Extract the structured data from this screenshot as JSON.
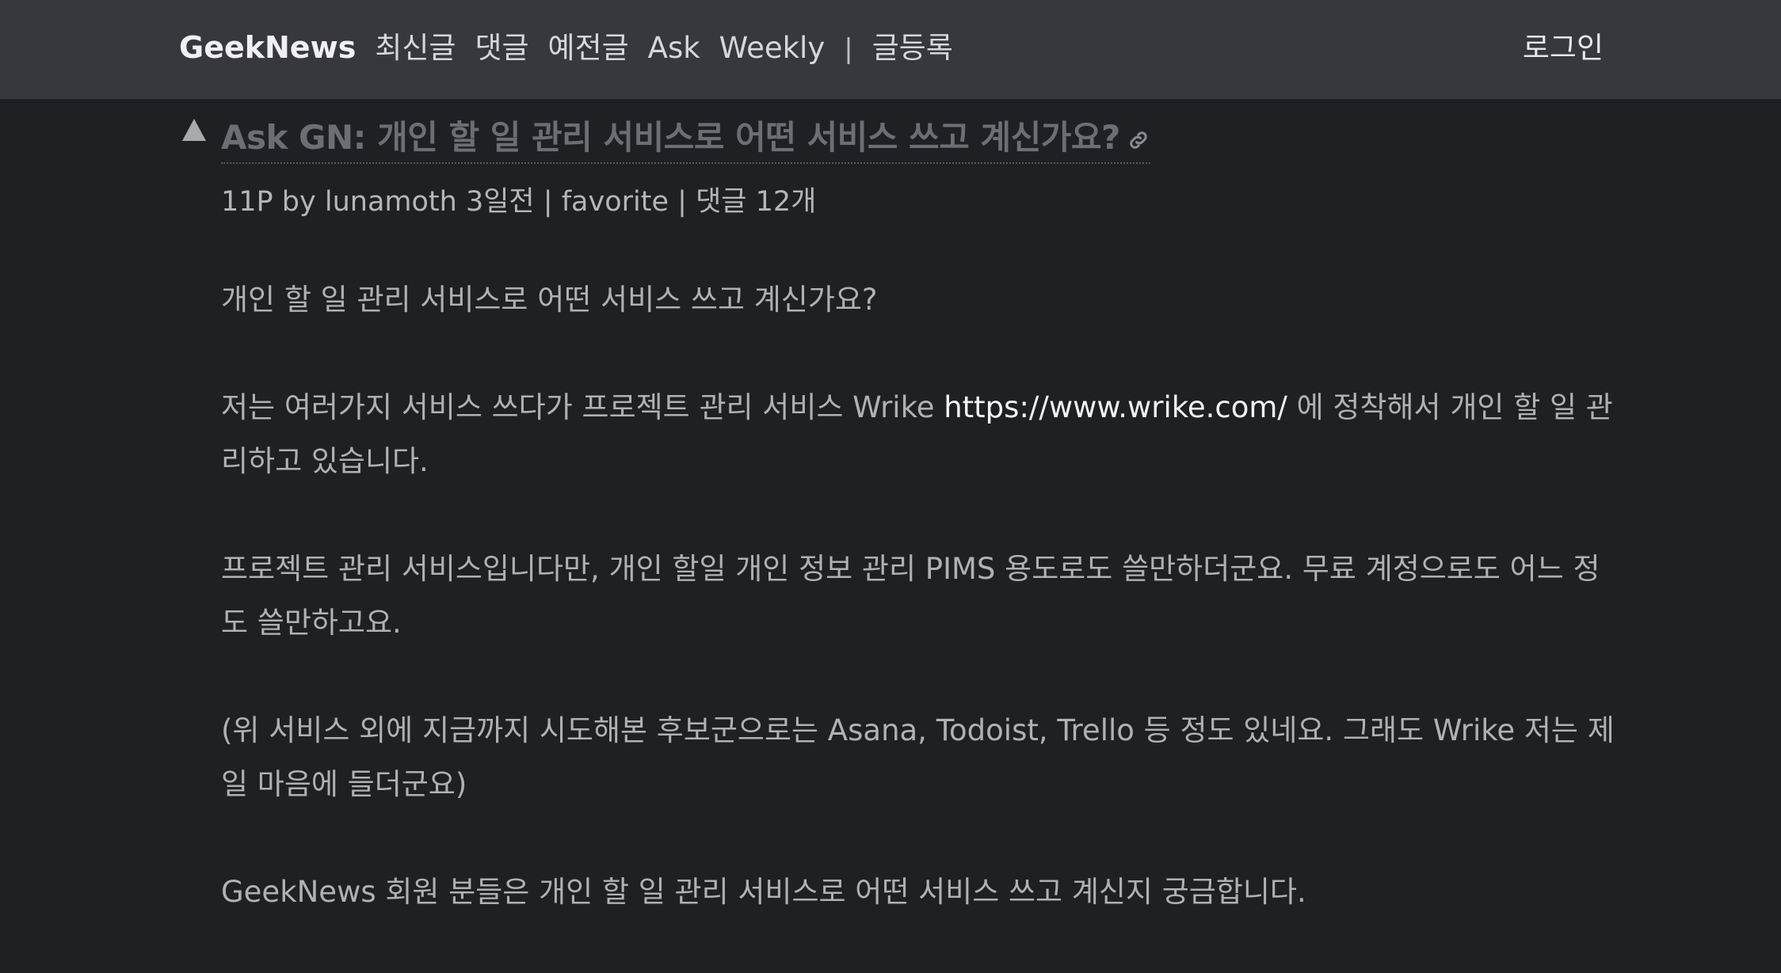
{
  "nav": {
    "brand": "GeekNews",
    "links": [
      "최신글",
      "댓글",
      "예전글",
      "Ask",
      "Weekly"
    ],
    "separator": "|",
    "submit": "글등록",
    "login": "로그인"
  },
  "post": {
    "title": "Ask GN: 개인 할 일 관리 서비스로 어떤 서비스 쓰고 계신가요?",
    "meta": {
      "points": "11P",
      "by": "by",
      "author": "lunamoth",
      "time": "3일전",
      "favorite": "favorite",
      "comments": "댓글 12개"
    },
    "body": {
      "p1": "개인 할 일 관리 서비스로 어떤 서비스 쓰고 계신가요?",
      "p2_before": "저는 여러가지 서비스 쓰다가 프로젝트 관리 서비스 Wrike ",
      "p2_link": "https://www.wrike.com/",
      "p2_after": " 에 정착해서 개인 할 일 관리하고 있습니다.",
      "p3": "프로젝트 관리 서비스입니다만, 개인 할일 개인 정보 관리 PIMS 용도로도 쓸만하더군요. 무료 계정으로도 어느 정도 쓸만하고요.",
      "p4": "(위 서비스 외에 지금까지 시도해본 후보군으로는 Asana, Todoist, Trello 등 정도 있네요. 그래도 Wrike 저는 제일 마음에 들더군요)",
      "p5": "GeekNews 회원 분들은 개인 할 일 관리 서비스로 어떤 서비스 쓰고 계신지 궁금합니다."
    }
  },
  "icons": {
    "vote": "upvote-triangle-icon",
    "link": "chain-link-icon"
  },
  "colors": {
    "topbar": "#37383d",
    "background": "#1f2023",
    "title": "#6d6e73",
    "body_text": "#b0b1b5",
    "link_text": "#f2f3f5"
  }
}
